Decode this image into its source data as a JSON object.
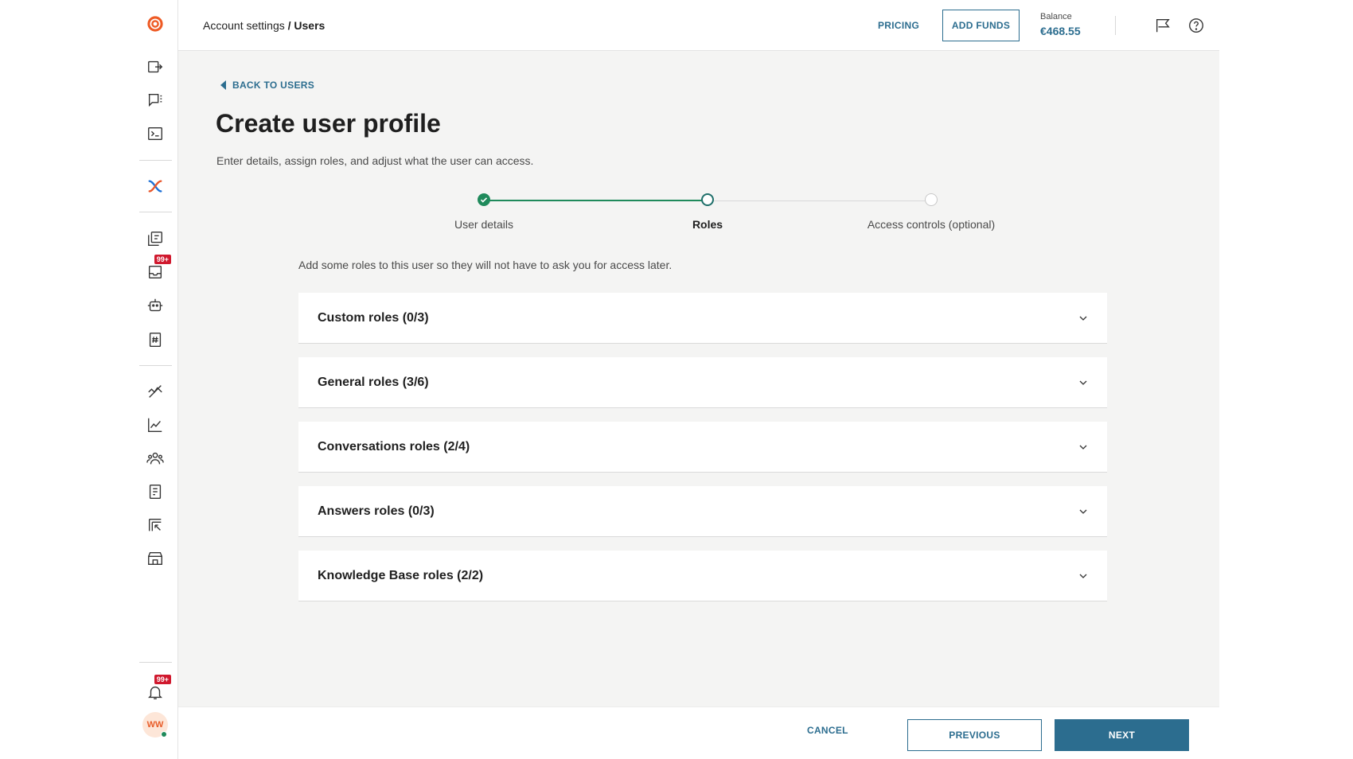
{
  "header": {
    "breadcrumb_parent": "Account settings",
    "breadcrumb_separator": "/",
    "breadcrumb_current": "Users",
    "pricing_label": "PRICING",
    "add_funds_label": "ADD FUNDS",
    "balance_label": "Balance",
    "balance_value": "€468.55",
    "icons": [
      "flag-icon",
      "help-icon"
    ]
  },
  "sidebar": {
    "logo": "infobip-logo-icon",
    "items": [
      "export-icon",
      "chat-list-icon",
      "terminal-icon",
      "flows-icon",
      "campaigns-icon",
      "inbox-icon",
      "bot-icon",
      "numbers-icon",
      "analytics-icon",
      "chart-icon",
      "people-icon",
      "logs-icon",
      "exchange-icon",
      "store-icon"
    ],
    "badges": {
      "inbox": "99+",
      "notifications": "99+"
    },
    "notifications_icon": "bell-icon",
    "avatar_initials": "WW"
  },
  "main": {
    "back_label": "BACK TO USERS",
    "title": "Create user profile",
    "subtitle": "Enter details, assign roles, and adjust what the user can access.",
    "steps": [
      {
        "label": "User details",
        "state": "complete"
      },
      {
        "label": "Roles",
        "state": "active"
      },
      {
        "label": "Access controls (optional)",
        "state": "pending"
      }
    ],
    "intro": "Add some roles to this user so they will not have to ask you for access later.",
    "role_groups": [
      {
        "title": "Custom roles (0/3)"
      },
      {
        "title": "General roles (3/6)"
      },
      {
        "title": "Conversations roles (2/4)"
      },
      {
        "title": "Answers roles (0/3)"
      },
      {
        "title": "Knowledge Base roles (2/2)"
      }
    ]
  },
  "footer": {
    "cancel_label": "CANCEL",
    "previous_label": "PREVIOUS",
    "next_label": "NEXT"
  },
  "colors": {
    "accent": "#2c6d8f",
    "success": "#1f8a5b",
    "brand_orange": "#e85d2a",
    "badge_red": "#d0192e"
  }
}
